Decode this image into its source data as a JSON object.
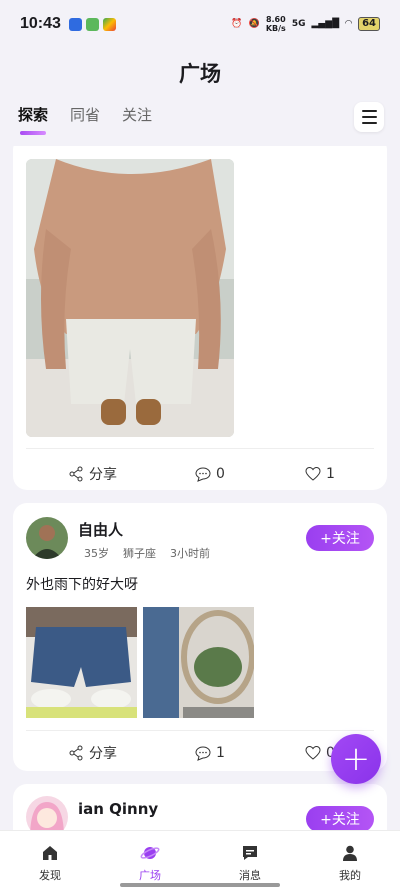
{
  "status_bar": {
    "time": "10:43",
    "speed_value": "8.60",
    "speed_unit": "KB/s",
    "network": "5G",
    "battery": "64"
  },
  "title": "广场",
  "tabs": [
    {
      "label": "探索"
    },
    {
      "label": "同省"
    },
    {
      "label": "关注"
    }
  ],
  "posts": [
    {
      "actions": {
        "share": "分享",
        "comments": "0",
        "likes": "1"
      }
    },
    {
      "user": {
        "name": "自由人",
        "age": "35岁",
        "zodiac": "狮子座",
        "time": "3小时前"
      },
      "follow_label": "+关注",
      "text": "外也雨下的好大呀",
      "actions": {
        "share": "分享",
        "comments": "1",
        "likes": "0"
      }
    },
    {
      "user": {
        "name": "ian Qinny"
      },
      "follow_label": "+关注"
    }
  ],
  "bottom_nav": [
    {
      "label": "发现",
      "icon": "home-icon"
    },
    {
      "label": "广场",
      "icon": "planet-icon"
    },
    {
      "label": "消息",
      "icon": "message-icon"
    },
    {
      "label": "我的",
      "icon": "user-icon"
    }
  ],
  "colors": {
    "accent": "#9a3ff0",
    "background": "#f3f2f8"
  }
}
